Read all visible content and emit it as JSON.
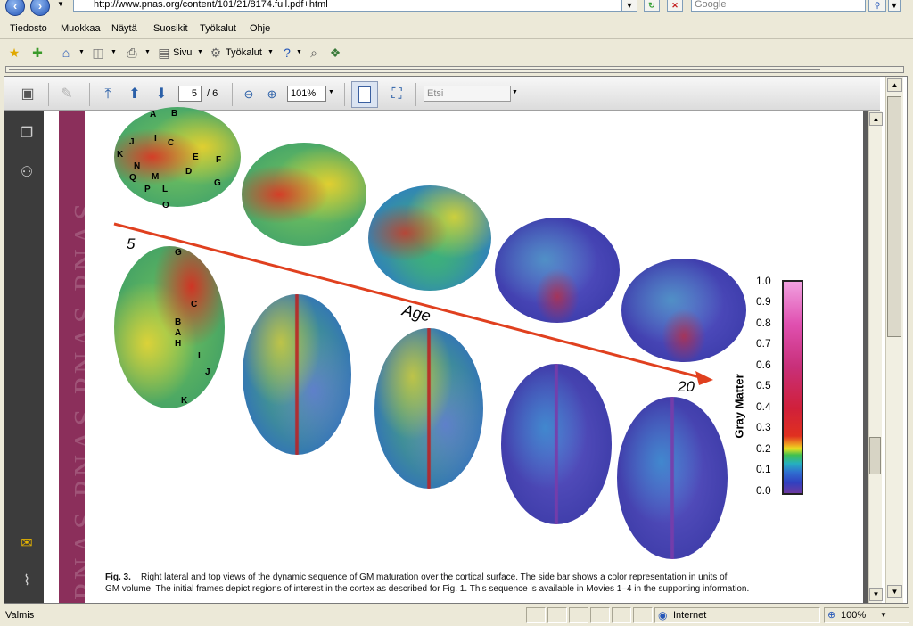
{
  "browser": {
    "url": "http://www.pnas.org/content/101/21/8174.full.pdf+html",
    "search_placeholder": "Google",
    "menu": [
      "Tiedosto",
      "Muokkaa",
      "Näytä",
      "Suosikit",
      "Työkalut",
      "Ohje"
    ],
    "toolbar": {
      "page_label": "Sivu",
      "tools_label": "Työkalut"
    },
    "status": {
      "text": "Valmis",
      "zone": "Internet",
      "zoom": "100%"
    }
  },
  "reader": {
    "page_current": "5",
    "page_total": "/ 6",
    "zoom": "101%",
    "find_placeholder": "Etsi"
  },
  "document": {
    "watermark": "PNAS PNAS PNAS PNAS",
    "figure": {
      "age_start": "5",
      "age_end": "20",
      "age_label": "Age",
      "roi_side": [
        "B",
        "A",
        "J",
        "I",
        "C",
        "K",
        "E",
        "N",
        "F",
        "M",
        "D",
        "Q",
        "G",
        "P",
        "L",
        "O"
      ],
      "roi_top": [
        "G",
        "C",
        "B",
        "A",
        "H",
        "I",
        "J",
        "K"
      ],
      "colorbar_label": "Gray Matter",
      "colorbar_ticks": [
        "1.0",
        "0.9",
        "0.8",
        "0.7",
        "0.6",
        "0.5",
        "0.4",
        "0.3",
        "0.2",
        "0.1",
        "0.0"
      ]
    },
    "caption": {
      "label": "Fig. 3.",
      "line1": "Right lateral and top views of the dynamic sequence of GM maturation over the cortical surface. The side bar shows a color representation in units of",
      "line2": "GM volume. The initial frames depict regions of interest in the cortex as described for Fig. 1. This sequence is available in Movies 1–4 in the supporting information."
    }
  }
}
